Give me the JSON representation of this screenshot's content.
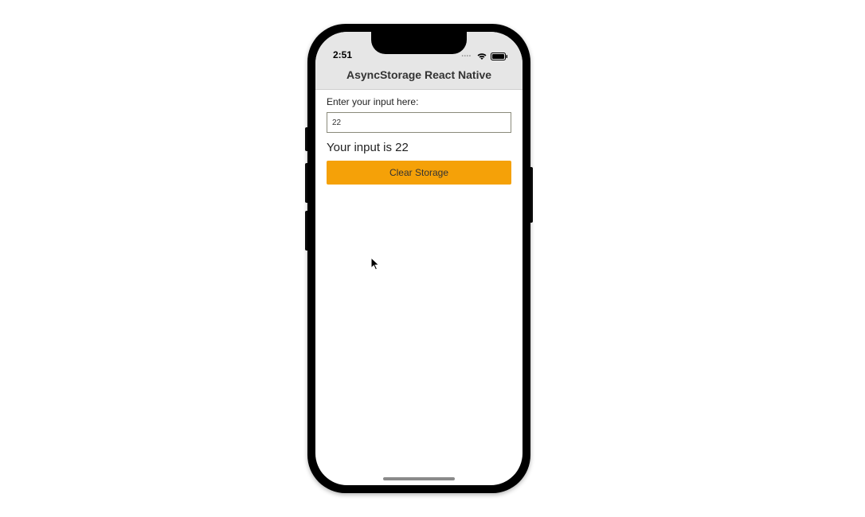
{
  "statusBar": {
    "time": "2:51"
  },
  "header": {
    "title": "AsyncStorage React Native"
  },
  "form": {
    "label": "Enter your input here:",
    "value": "22",
    "outputPrefix": "Your input is ",
    "outputValue": "22",
    "clearButton": "Clear Storage"
  },
  "colors": {
    "accent": "#f5a108",
    "headerBg": "#e6e6e6"
  }
}
